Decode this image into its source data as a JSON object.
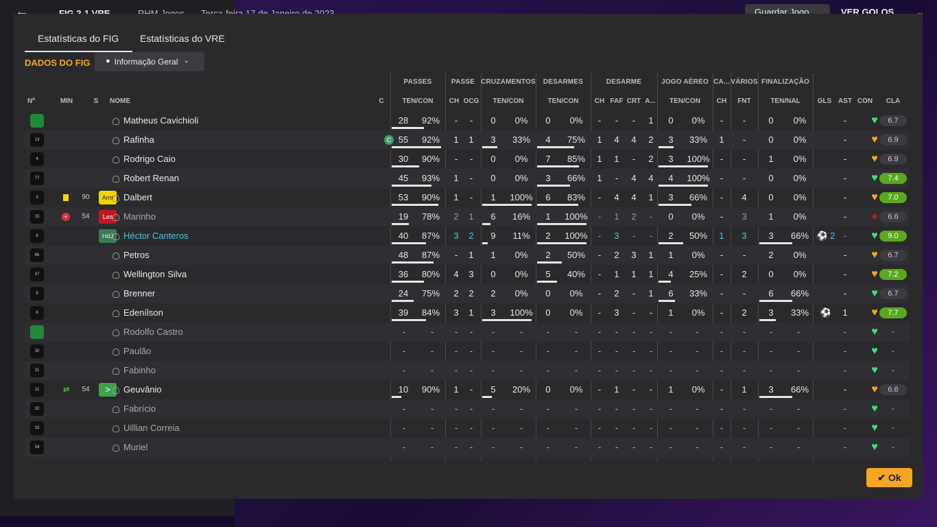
{
  "topbar": {
    "back_icon": "←",
    "score": "FIG 2-1 VRE",
    "manager": "RHM Jogos",
    "date": "Terça-feira 17 de Janeiro de 2023",
    "save": "Guardar Jogo",
    "goals": "VER GOLOS",
    "chev": "⌄"
  },
  "tabs": [
    {
      "label": "Estatísticas do FIG"
    },
    {
      "label": "Estatísticas do VRE"
    }
  ],
  "section_title": "DADOS DO FIG",
  "filter": {
    "icon": "●",
    "label": "Informação Geral",
    "chevron": "⌄"
  },
  "groups": {
    "passes": "PASSES",
    "passe": "PASSE",
    "cruz": "CRUZAMENTOS",
    "des": "DESARMES",
    "desarme": "DESARME",
    "aereo": "JOGO AÉREO",
    "ca": "CA...",
    "varios": "VÁRIOS",
    "fin": "FINALIZAÇÃO"
  },
  "cols": {
    "n": "Nº",
    "min": "MIN",
    "s": "S",
    "nome": "NOME",
    "c": "C",
    "tencon": "TEN/CON",
    "ch": "CH",
    "ocg": "OCG",
    "faf": "FAF",
    "crt": "CRT",
    "a": "A...",
    "fnt": "FNT",
    "tennal": "TEN/NAL",
    "gls": "GLS",
    "ast": "AST",
    "con": "CON",
    "cla": "CLA"
  },
  "ok": "Ok",
  "rows": [
    {
      "name": "Matheus Cavichioli",
      "gk": true,
      "p": [
        "28",
        "92%"
      ],
      "pch": "-",
      "ocg": "-",
      "cz": [
        "0",
        "0%"
      ],
      "ds": [
        "0",
        "0%"
      ],
      "d": [
        "-",
        "-",
        "-",
        "1"
      ],
      "ae": [
        "0",
        "0%"
      ],
      "ca": "-",
      "fnt": "-",
      "fin": [
        "0",
        "0%"
      ],
      "gls": "",
      "ast": "-",
      "cla": "6.7",
      "pbar": 0.65
    },
    {
      "name": "Rafinha",
      "kit": "13",
      "cap": "C",
      "p": [
        "55",
        "92%"
      ],
      "pch": "1",
      "ocg": "1",
      "cz": [
        "3",
        "33%"
      ],
      "ds": [
        "4",
        "75%"
      ],
      "d": [
        "1",
        "4",
        "4",
        "2"
      ],
      "ae": [
        "3",
        "33%"
      ],
      "ca": "1",
      "fnt": "-",
      "fin": [
        "0",
        "0%"
      ],
      "gls": "",
      "ast": "-",
      "cla": "6.9",
      "pbar": 1,
      "czbar": 0.3,
      "dsbar": 0.75,
      "aebar": 0.3
    },
    {
      "name": "Rodrigo Caio",
      "kit": "4",
      "p": [
        "30",
        "90%"
      ],
      "pch": "-",
      "ocg": "-",
      "cz": [
        "0",
        "0%"
      ],
      "ds": [
        "7",
        "85%"
      ],
      "d": [
        "1",
        "1",
        "-",
        "2"
      ],
      "ae": [
        "3",
        "100%"
      ],
      "ca": "-",
      "fnt": "-",
      "fin": [
        "1",
        "0%"
      ],
      "gls": "",
      "ast": "-",
      "cla": "6.9",
      "pbar": 0.55,
      "dsbar": 0.85,
      "aebar": 1
    },
    {
      "name": "Robert Renan",
      "kit": "77",
      "p": [
        "45",
        "93%"
      ],
      "pch": "1",
      "ocg": "-",
      "cz": [
        "0",
        "0%"
      ],
      "ds": [
        "3",
        "66%"
      ],
      "d": [
        "1",
        "-",
        "4",
        "4"
      ],
      "ae": [
        "4",
        "100%"
      ],
      "ca": "-",
      "fnt": "-",
      "fin": [
        "0",
        "0%"
      ],
      "gls": "",
      "ast": "-",
      "cla": "7.4",
      "good": true,
      "pbar": 0.8,
      "dsbar": 0.66,
      "aebar": 1
    },
    {
      "name": "Dalbert",
      "kit": "3",
      "yc": true,
      "min": "90",
      "badge": "Amr",
      "bcls": "b-amr",
      "p": [
        "53",
        "90%"
      ],
      "pch": "1",
      "ocg": "-",
      "cz": [
        "1",
        "100%"
      ],
      "ds": [
        "6",
        "83%"
      ],
      "d": [
        "-",
        "4",
        "4",
        "1"
      ],
      "ae": [
        "3",
        "66%"
      ],
      "ca": "-",
      "fnt": "4",
      "fin": [
        "0",
        "0%"
      ],
      "gls": "",
      "ast": "-",
      "cla": "7.0",
      "good": true,
      "pbar": 0.95,
      "czbar": 1,
      "dsbar": 0.83,
      "aebar": 0.66
    },
    {
      "name": "Marinho",
      "kit": "15",
      "dim": true,
      "inj": true,
      "min": "54",
      "badge": "Les",
      "bcls": "b-les",
      "p": [
        "19",
        "78%"
      ],
      "pch": "2",
      "ocg": "1",
      "cz": [
        "6",
        "16%"
      ],
      "ds": [
        "1",
        "100%"
      ],
      "d": [
        "-",
        "1",
        "2",
        "-"
      ],
      "ae": [
        "0",
        "0%"
      ],
      "ca": "-",
      "fnt": "3",
      "fin": [
        "1",
        "0%"
      ],
      "gls": "",
      "ast": "-",
      "cla": "6.6",
      "pbar": 0.35,
      "czbar": 0.16,
      "dsbar": 1,
      "grey": true,
      "red": true
    },
    {
      "name": "Héctor Canteros",
      "kit": "6",
      "hl": true,
      "badge": "HdJ",
      "bcls": "b-hdj",
      "p": [
        "40",
        "87%"
      ],
      "pch": "3",
      "ocg": "2",
      "cz": [
        "9",
        "11%"
      ],
      "ds": [
        "2",
        "100%"
      ],
      "d": [
        "-",
        "3",
        "-",
        "-"
      ],
      "ae": [
        "2",
        "50%"
      ],
      "ca": "1",
      "fnt": "3",
      "fin": [
        "3",
        "66%"
      ],
      "gls": "⚽ 2",
      "ast": "-",
      "cla": "9.0",
      "good": true,
      "pbar": 0.7,
      "czbar": 0.11,
      "dsbar": 1,
      "aebar": 0.5,
      "finbar": 0.66,
      "teal": true
    },
    {
      "name": "Petros",
      "kit": "66",
      "p": [
        "48",
        "87%"
      ],
      "pch": "-",
      "ocg": "1",
      "cz": [
        "1",
        "0%"
      ],
      "ds": [
        "2",
        "50%"
      ],
      "d": [
        "-",
        "2",
        "3",
        "1"
      ],
      "ae": [
        "1",
        "0%"
      ],
      "ca": "-",
      "fnt": "-",
      "fin": [
        "2",
        "0%"
      ],
      "gls": "",
      "ast": "-",
      "cla": "6.7",
      "pbar": 0.85,
      "dsbar": 0.5
    },
    {
      "name": "Wellington Silva",
      "kit": "37",
      "p": [
        "36",
        "80%"
      ],
      "pch": "4",
      "ocg": "3",
      "cz": [
        "0",
        "0%"
      ],
      "ds": [
        "5",
        "40%"
      ],
      "d": [
        "-",
        "1",
        "1",
        "1"
      ],
      "ae": [
        "4",
        "25%"
      ],
      "ca": "-",
      "fnt": "2",
      "fin": [
        "0",
        "0%"
      ],
      "gls": "",
      "ast": "-",
      "cla": "7.2",
      "good": true,
      "pbar": 0.65,
      "dsbar": 0.4,
      "aebar": 0.25
    },
    {
      "name": "Brenner",
      "kit": "9",
      "p": [
        "24",
        "75%"
      ],
      "pch": "2",
      "ocg": "2",
      "cz": [
        "2",
        "0%"
      ],
      "ds": [
        "0",
        "0%"
      ],
      "d": [
        "-",
        "2",
        "-",
        "1"
      ],
      "ae": [
        "6",
        "33%"
      ],
      "ca": "-",
      "fnt": "-",
      "fin": [
        "6",
        "66%"
      ],
      "gls": "",
      "ast": "-",
      "cla": "6.7",
      "pbar": 0.45,
      "aebar": 0.33,
      "finbar": 0.66
    },
    {
      "name": "Edenílson",
      "kit": "8",
      "p": [
        "39",
        "84%"
      ],
      "pch": "3",
      "ocg": "1",
      "cz": [
        "3",
        "100%"
      ],
      "ds": [
        "0",
        "0%"
      ],
      "d": [
        "-",
        "3",
        "-",
        "-"
      ],
      "ae": [
        "1",
        "0%"
      ],
      "ca": "-",
      "fnt": "2",
      "fin": [
        "3",
        "33%"
      ],
      "gls": "⚽",
      "ast": "1",
      "cla": "7.7",
      "good": true,
      "pbar": 0.7,
      "czbar": 1,
      "finbar": 0.33
    },
    {
      "name": "Rodolfo Castro",
      "gk": true,
      "dim": true,
      "empty": true
    },
    {
      "name": "Paulão",
      "kit": "30",
      "dim": true,
      "empty": true
    },
    {
      "name": "Fabinho",
      "kit": "31",
      "dim": true,
      "empty": true
    },
    {
      "name": "Geuvânio",
      "kit": "11",
      "sub": true,
      "min": "54",
      "badge": ">",
      "bcls": "b-sub",
      "p": [
        "10",
        "90%"
      ],
      "pch": "1",
      "ocg": "-",
      "cz": [
        "5",
        "20%"
      ],
      "ds": [
        "0",
        "0%"
      ],
      "d": [
        "-",
        "1",
        "-",
        "-"
      ],
      "ae": [
        "1",
        "0%"
      ],
      "ca": "-",
      "fnt": "1",
      "fin": [
        "3",
        "66%"
      ],
      "gls": "",
      "ast": "-",
      "cla": "6.6",
      "pbar": 0.2,
      "czbar": 0.2,
      "finbar": 0.66
    },
    {
      "name": "Fabrício",
      "kit": "32",
      "dim": true,
      "empty": true
    },
    {
      "name": "Uillian Correia",
      "kit": "33",
      "dim": true,
      "empty": true
    },
    {
      "name": "Muriel",
      "kit": "34",
      "dim": true,
      "empty": true
    }
  ]
}
